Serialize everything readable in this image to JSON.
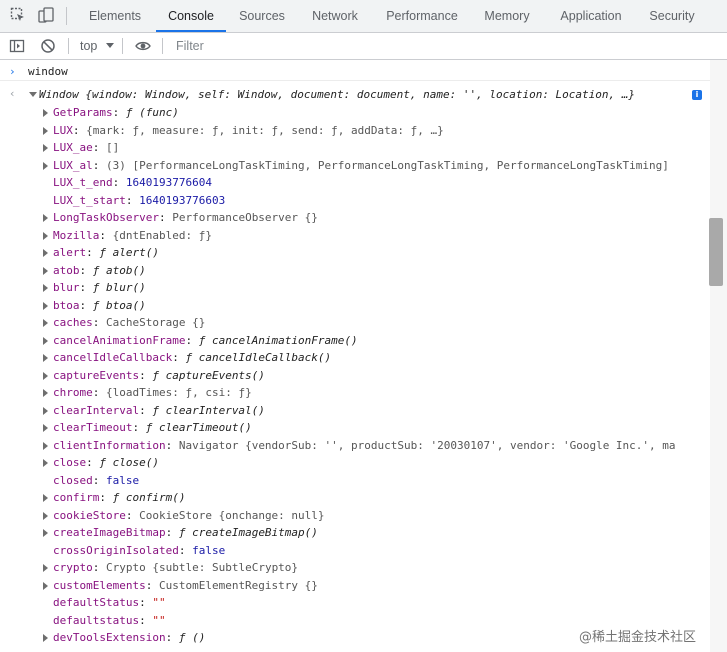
{
  "tabs": [
    {
      "label": "Elements"
    },
    {
      "label": "Console"
    },
    {
      "label": "Sources"
    },
    {
      "label": "Network"
    },
    {
      "label": "Performance"
    },
    {
      "label": "Memory"
    },
    {
      "label": "Application"
    },
    {
      "label": "Security"
    }
  ],
  "active_tab": "Console",
  "toolbar": {
    "context": "top",
    "filter_placeholder": "Filter"
  },
  "console": {
    "input": "window",
    "result_header": "Window {window: Window, self: Window, document: document, name: '', location: Location, …}",
    "properties": [
      {
        "key": "GetParams",
        "colon": ": ",
        "value": "ƒ (func)",
        "kind": "fn",
        "expandable": true
      },
      {
        "key": "LUX",
        "colon": ": ",
        "value": "{mark: ƒ, measure: ƒ, init: ƒ, send: ƒ, addData: ƒ, …}",
        "kind": "obj",
        "expandable": true
      },
      {
        "key": "LUX_ae",
        "colon": ": ",
        "value": "[]",
        "kind": "obj",
        "expandable": true
      },
      {
        "key": "LUX_al",
        "colon": ": ",
        "value": "(3) [PerformanceLongTaskTiming, PerformanceLongTaskTiming, PerformanceLongTaskTiming]",
        "kind": "obj",
        "expandable": true
      },
      {
        "key": "LUX_t_end",
        "colon": ": ",
        "value": "1640193776604",
        "kind": "num",
        "expandable": false
      },
      {
        "key": "LUX_t_start",
        "colon": ": ",
        "value": "1640193776603",
        "kind": "num",
        "expandable": false
      },
      {
        "key": "LongTaskObserver",
        "colon": ": ",
        "value": "PerformanceObserver {}",
        "kind": "obj",
        "expandable": true
      },
      {
        "key": "Mozilla",
        "colon": ": ",
        "value": "{dntEnabled: ƒ}",
        "kind": "obj",
        "expandable": true
      },
      {
        "key": "alert",
        "colon": ": ",
        "value": "ƒ alert()",
        "kind": "fn",
        "expandable": true
      },
      {
        "key": "atob",
        "colon": ": ",
        "value": "ƒ atob()",
        "kind": "fn",
        "expandable": true
      },
      {
        "key": "blur",
        "colon": ": ",
        "value": "ƒ blur()",
        "kind": "fn",
        "expandable": true
      },
      {
        "key": "btoa",
        "colon": ": ",
        "value": "ƒ btoa()",
        "kind": "fn",
        "expandable": true
      },
      {
        "key": "caches",
        "colon": ": ",
        "value": "CacheStorage {}",
        "kind": "obj",
        "expandable": true
      },
      {
        "key": "cancelAnimationFrame",
        "colon": ": ",
        "value": "ƒ cancelAnimationFrame()",
        "kind": "fn",
        "expandable": true
      },
      {
        "key": "cancelIdleCallback",
        "colon": ": ",
        "value": "ƒ cancelIdleCallback()",
        "kind": "fn",
        "expandable": true
      },
      {
        "key": "captureEvents",
        "colon": ": ",
        "value": "ƒ captureEvents()",
        "kind": "fn",
        "expandable": true
      },
      {
        "key": "chrome",
        "colon": ": ",
        "value": "{loadTimes: ƒ, csi: ƒ}",
        "kind": "obj",
        "expandable": true
      },
      {
        "key": "clearInterval",
        "colon": ": ",
        "value": "ƒ clearInterval()",
        "kind": "fn",
        "expandable": true
      },
      {
        "key": "clearTimeout",
        "colon": ": ",
        "value": "ƒ clearTimeout()",
        "kind": "fn",
        "expandable": true
      },
      {
        "key": "clientInformation",
        "colon": ": ",
        "value": "Navigator {vendorSub: '', productSub: '20030107', vendor: 'Google Inc.', ma",
        "kind": "obj",
        "expandable": true
      },
      {
        "key": "close",
        "colon": ": ",
        "value": "ƒ close()",
        "kind": "fn",
        "expandable": true
      },
      {
        "key": "closed",
        "colon": ": ",
        "value": "false",
        "kind": "bool",
        "expandable": false
      },
      {
        "key": "confirm",
        "colon": ": ",
        "value": "ƒ confirm()",
        "kind": "fn",
        "expandable": true
      },
      {
        "key": "cookieStore",
        "colon": ": ",
        "value": "CookieStore {onchange: null}",
        "kind": "obj",
        "expandable": true
      },
      {
        "key": "createImageBitmap",
        "colon": ": ",
        "value": "ƒ createImageBitmap()",
        "kind": "fn",
        "expandable": true
      },
      {
        "key": "crossOriginIsolated",
        "colon": ": ",
        "value": "false",
        "kind": "bool",
        "expandable": false
      },
      {
        "key": "crypto",
        "colon": ": ",
        "value": "Crypto {subtle: SubtleCrypto}",
        "kind": "obj",
        "expandable": true
      },
      {
        "key": "customElements",
        "colon": ": ",
        "value": "CustomElementRegistry {}",
        "kind": "obj",
        "expandable": true
      },
      {
        "key": "defaultStatus",
        "colon": ": ",
        "value": "\"\"",
        "kind": "str",
        "expandable": false
      },
      {
        "key": "defaultstatus",
        "colon": ": ",
        "value": "\"\"",
        "kind": "str",
        "expandable": false
      },
      {
        "key": "devToolsExtension",
        "colon": ": ",
        "value": "ƒ ()",
        "kind": "fn",
        "expandable": true
      }
    ]
  },
  "watermark": "@稀土掘金技术社区"
}
